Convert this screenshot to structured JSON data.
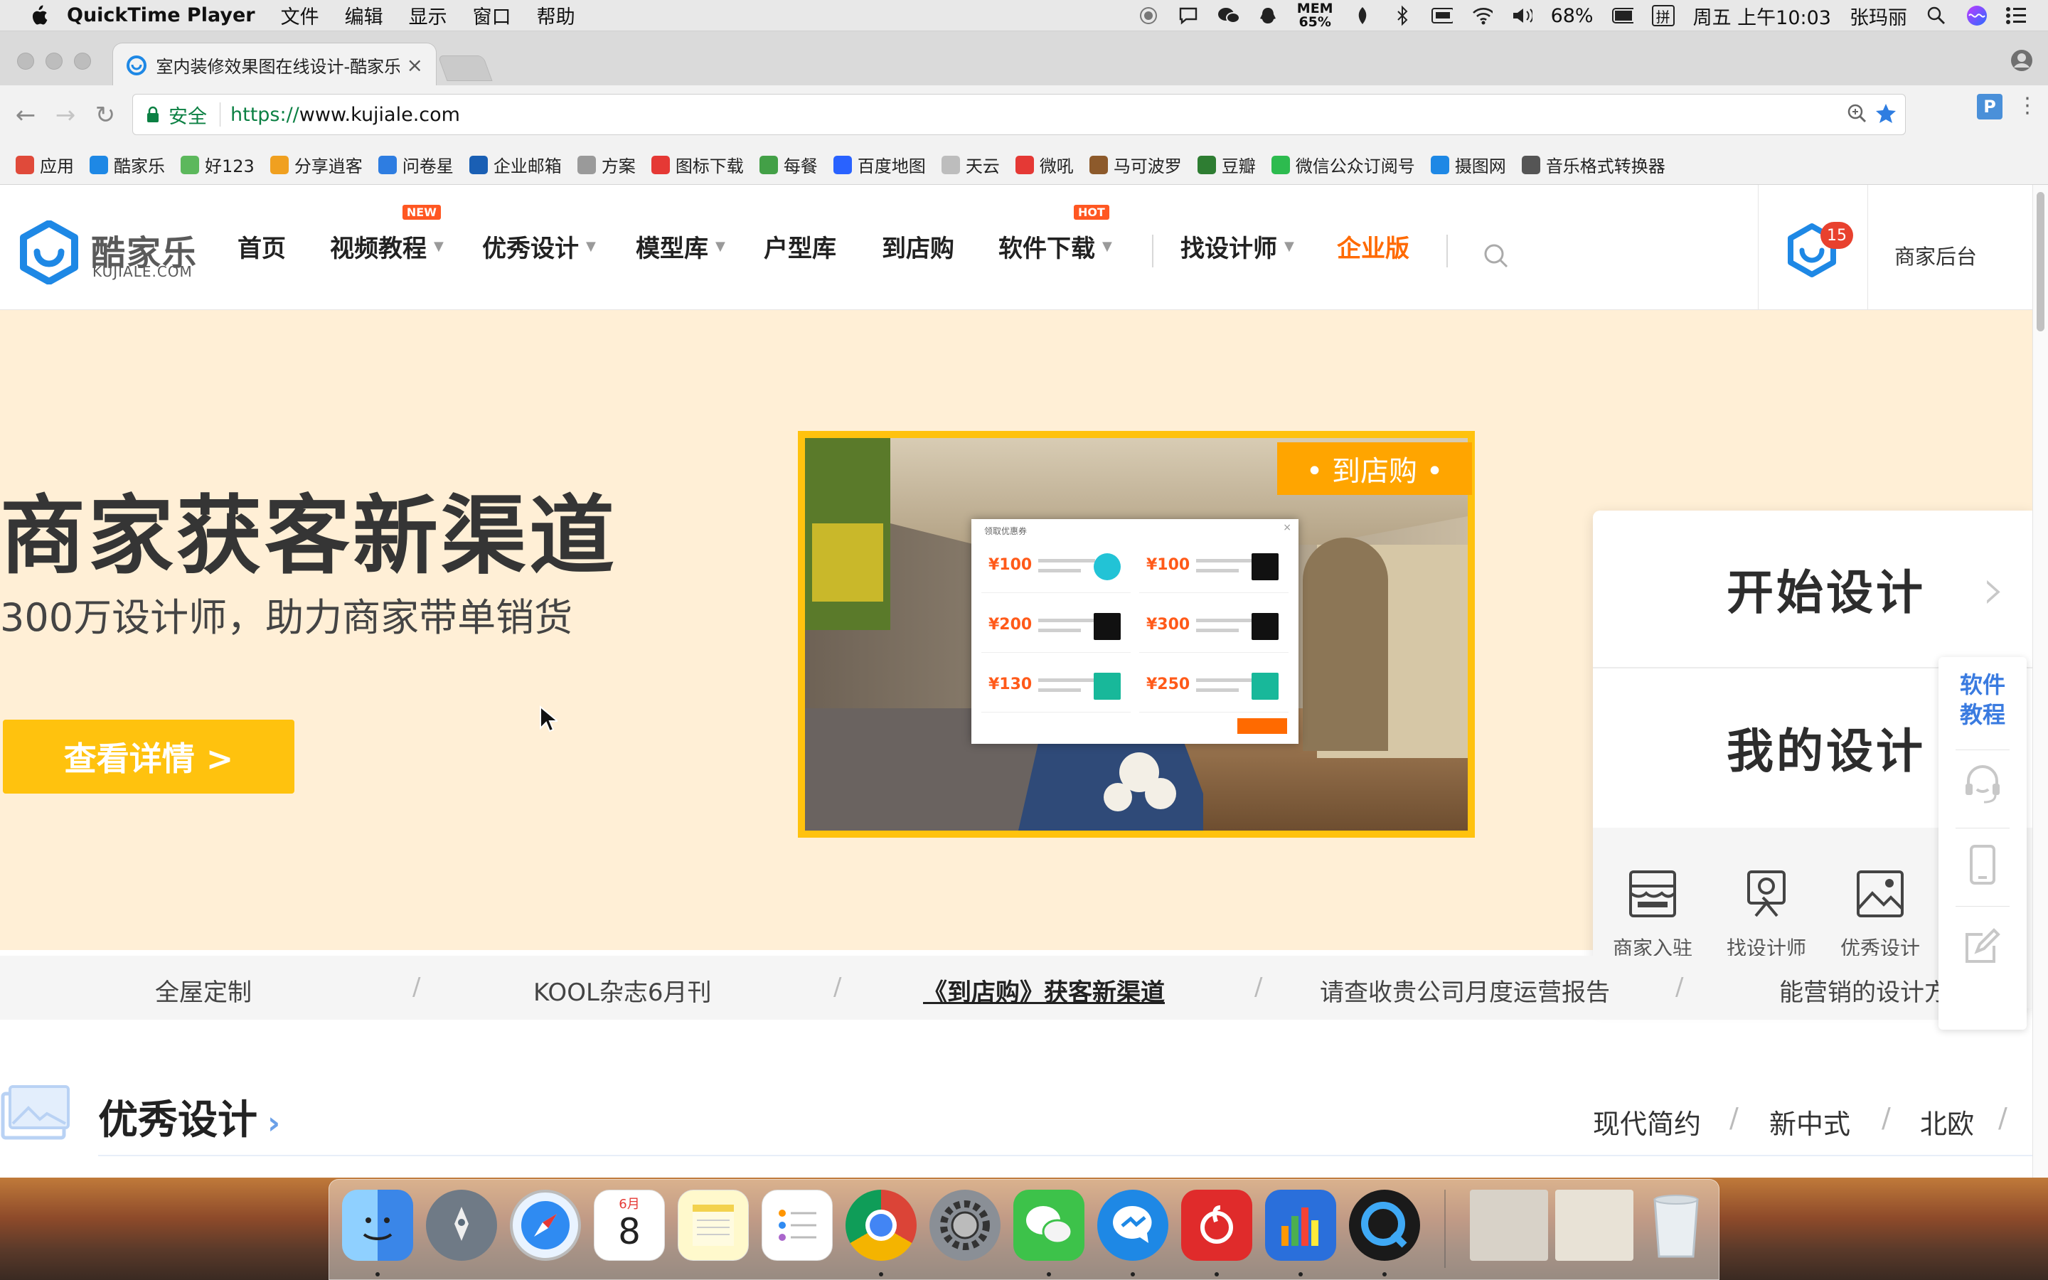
{
  "menubar": {
    "app_name": "QuickTime Player",
    "menus": [
      "文件",
      "编辑",
      "显示",
      "窗口",
      "帮助"
    ],
    "mem_label": "MEM",
    "mem_value": "65%",
    "battery": "68%",
    "input_method": "拼",
    "clock": "周五 上午10:03",
    "user": "张玛丽"
  },
  "browser": {
    "tab_title": "室内装修效果图在线设计-酷家乐",
    "secure_label": "安全",
    "url_scheme": "https://",
    "url_host": "www.kujiale.com",
    "ext_label": "P",
    "bookmarks": [
      {
        "label": "应用",
        "icon": "apps-grid-icon",
        "color": "#e04a3a"
      },
      {
        "label": "酷家乐",
        "icon": "kujiale-icon",
        "color": "#1e88e5"
      },
      {
        "label": "好123",
        "icon": "hao123-icon",
        "color": "#5cb85c"
      },
      {
        "label": "分享逍客",
        "icon": "fenxiang-icon",
        "color": "#f0a020"
      },
      {
        "label": "问卷星",
        "icon": "star-icon",
        "color": "#2e7de1"
      },
      {
        "label": "企业邮箱",
        "icon": "mail-icon",
        "color": "#1a5fb4"
      },
      {
        "label": "方案",
        "icon": "folder-icon",
        "color": "#9a9a9a"
      },
      {
        "label": "图标下载",
        "icon": "iconfont-icon",
        "color": "#e53935"
      },
      {
        "label": "每餐",
        "icon": "meican-icon",
        "color": "#43a047"
      },
      {
        "label": "百度地图",
        "icon": "baidu-map-icon",
        "color": "#2962ff"
      },
      {
        "label": "天云",
        "icon": "page-icon",
        "color": "#bdbdbd"
      },
      {
        "label": "微吼",
        "icon": "vhall-icon",
        "color": "#e53935"
      },
      {
        "label": "马可波罗",
        "icon": "camel-icon",
        "color": "#8d5a2b"
      },
      {
        "label": "豆瓣",
        "icon": "douban-icon",
        "color": "#2e7d32"
      },
      {
        "label": "微信公众订阅号",
        "icon": "wechat-icon",
        "color": "#2dbb4f"
      },
      {
        "label": "摄图网",
        "icon": "sheying-icon",
        "color": "#1e88e5"
      },
      {
        "label": "音乐格式转换器",
        "icon": "music-convert-icon",
        "color": "#555555"
      }
    ]
  },
  "site": {
    "logo_cn": "酷家乐",
    "logo_en": "KUJIALE.COM",
    "nav": [
      {
        "label": "首页",
        "caret": false,
        "badge": ""
      },
      {
        "label": "视频教程",
        "caret": true,
        "badge": "NEW"
      },
      {
        "label": "优秀设计",
        "caret": true,
        "badge": ""
      },
      {
        "label": "模型库",
        "caret": true,
        "badge": ""
      },
      {
        "label": "户型库",
        "caret": false,
        "badge": ""
      },
      {
        "label": "到店购",
        "caret": false,
        "badge": ""
      },
      {
        "label": "软件下载",
        "caret": true,
        "badge": "HOT"
      },
      {
        "label": "找设计师",
        "caret": true,
        "badge": ""
      }
    ],
    "enterprise_label": "企业版",
    "notification_count": "15",
    "merchant_link": "商家后台"
  },
  "hero": {
    "title": "商家获客新渠道",
    "subtitle": "300万设计师，助力商家带单销货",
    "button": "查看详情 >",
    "tag": "•  到店购  •",
    "coupon_title": "领取优惠券",
    "coupons": [
      "¥100",
      "¥100",
      "¥200",
      "¥300",
      "¥130",
      "¥250"
    ]
  },
  "quick_panel": {
    "start_design": "开始设计",
    "my_design": "我的设计",
    "items": [
      "商家入驻",
      "找设计师",
      "优秀设计"
    ]
  },
  "floatbar": {
    "tutorial": "软件教程"
  },
  "ticker": {
    "items": [
      "全屋定制",
      "KOOL杂志6月刊",
      "《到店购》获客新渠道",
      "请查收贵公司月度运营报告",
      "能营销的设计方"
    ],
    "separator": "/"
  },
  "section": {
    "title": "优秀设计",
    "arrow": "›",
    "tabs": [
      "现代简约",
      "新中式",
      "北欧"
    ]
  },
  "dock": {
    "calendar_month": "6月",
    "calendar_day": "8",
    "apps": [
      "finder",
      "launchpad",
      "safari",
      "calendar",
      "notes",
      "reminders",
      "chrome",
      "system-preferences",
      "wechat",
      "messenger",
      "netease-music",
      "keynote-charts",
      "quicktime"
    ]
  }
}
